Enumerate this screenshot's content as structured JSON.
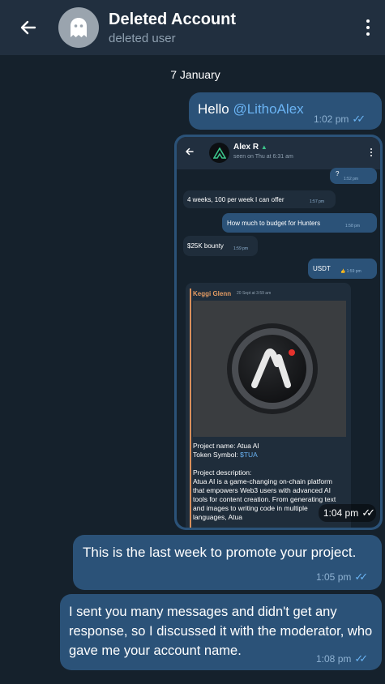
{
  "header": {
    "title": "Deleted Account",
    "subtitle": "deleted user",
    "back_icon": "arrow-left-icon",
    "menu_icon": "more-vertical-icon",
    "avatar_icon": "ghost-icon"
  },
  "date_separator": "7 January",
  "messages": [
    {
      "prefix": "Hello ",
      "mention": "@LithoAlex",
      "time": "1:02 pm"
    },
    {
      "type": "screenshot",
      "time": "1:04 pm",
      "inner": {
        "name": "Alex R",
        "status": "seen on Thu at 6:31 am",
        "messages": [
          {
            "text": "?",
            "time": "1:52 pm",
            "direction": "out"
          },
          {
            "text": "4 weeks, 100 per week I can offer",
            "time": "1:57 pm",
            "direction": "in"
          },
          {
            "text": "How much to budget for Hunters",
            "time": "1:58 pm",
            "direction": "out"
          },
          {
            "text": "$25K bounty",
            "time": "1:59 pm",
            "direction": "in"
          },
          {
            "text": "USDT",
            "time": "1:59 pm",
            "direction": "out"
          }
        ],
        "forward": {
          "author": "Keggi Glenn",
          "date": "20 Sept at 3:59 am",
          "project_name": "Project name: Atua AI",
          "token_label": "Token Symbol: ",
          "token_symbol": "$TUA",
          "desc_label": "Project description:",
          "description": "Atua AI is a game-changing on-chain platform that empowers Web3 users with advanced AI tools for content creation. From generating text and images to writing code in multiple languages, Atua"
        }
      }
    },
    {
      "text": "This is the last week to promote your project.",
      "time": "1:05 pm"
    },
    {
      "text": "I sent you many messages and didn't get any response, so I discussed it with the moderator, who gave me your account name.",
      "time": "1:08 pm"
    }
  ],
  "colors": {
    "background": "#15212c",
    "header": "#212f3f",
    "outgoing_bubble": "#2b5278",
    "accent": "#6ab3f3"
  }
}
